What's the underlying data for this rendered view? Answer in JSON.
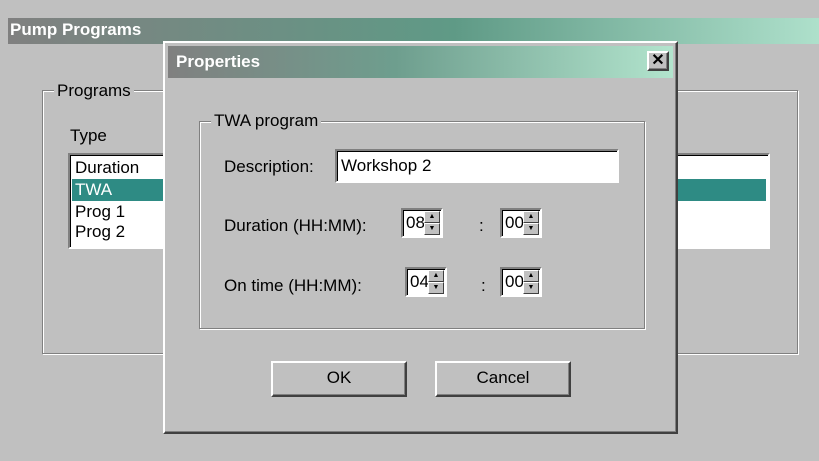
{
  "main": {
    "title": "Pump Programs",
    "group_label": "Programs",
    "list_header": "Type",
    "programs": [
      "Duration",
      "TWA",
      "Prog 1",
      "Prog 2"
    ],
    "selected_program": "TWA"
  },
  "dialog": {
    "title": "Properties",
    "close_glyph": "✕",
    "group_label": "TWA program",
    "description_label": "Description:",
    "description_value": "Workshop 2",
    "duration_label": "Duration (HH:MM):",
    "duration_hours": "08",
    "duration_minutes": "00",
    "ontime_label": "On time (HH:MM):",
    "ontime_hours": "04",
    "ontime_minutes": "00",
    "separator": ":",
    "ok_label": "OK",
    "cancel_label": "Cancel"
  },
  "colors": {
    "selection": "#2e8b84",
    "window_bg": "#c0c0c0"
  },
  "icons": {
    "spin_up": "spin-up-arrow-icon",
    "spin_down": "spin-down-arrow-icon",
    "close": "close-icon"
  }
}
